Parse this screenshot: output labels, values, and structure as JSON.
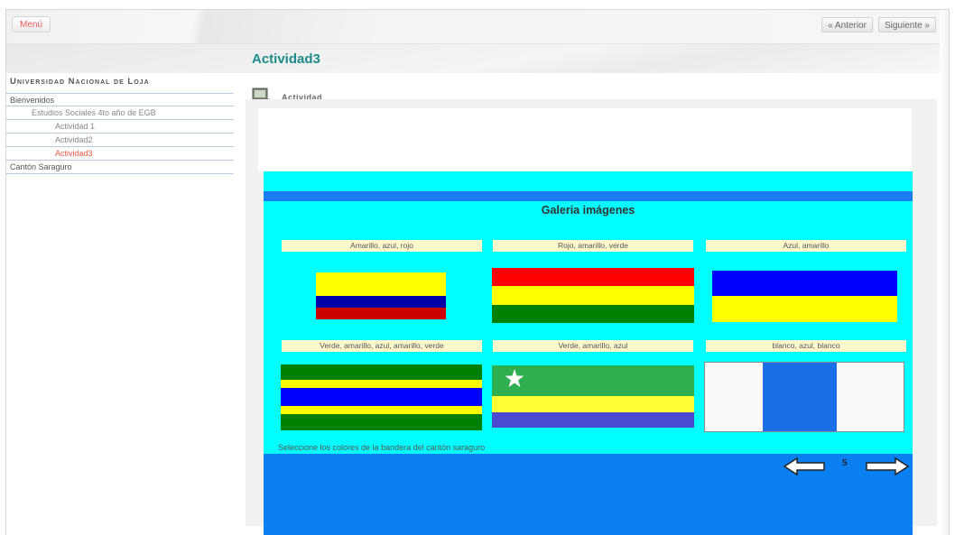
{
  "topbar": {
    "menu_label": "Menú",
    "prev_label": "« Anterior",
    "next_label": "Siguiente »"
  },
  "page_title": "Actividad3",
  "sidebar": {
    "university": "Universidad Nacional de Loja",
    "items": [
      {
        "label": "Bienvenidos",
        "level": 0
      },
      {
        "label": "Estudios Sociales 4to año de EGB",
        "level": 1
      },
      {
        "label": "Actividad 1",
        "level": 2
      },
      {
        "label": "Actividad2",
        "level": 2
      },
      {
        "label": "Actividad3",
        "level": 2,
        "active": true
      },
      {
        "label": "Cantón Saraguro",
        "level": 0
      }
    ]
  },
  "activity": {
    "header_label": "Actividad",
    "gallery_title": "Galeria imágenes",
    "captions": [
      "Amarillo, azul, rojo",
      "Rojo, amarillo, verde",
      "Azul, amarillo",
      "Verde, amarillo, azul, amarillo, verde",
      "Verde, amarillo, azul",
      "blanco, azul, blanco"
    ],
    "instruction": "Seleccione los colores de la bandera del cantón saraguro",
    "page_number": "5"
  },
  "colors": {
    "accent_title": "#1e8a8a",
    "stage_bg": "#00ffff",
    "stage_bar": "#1a7cf0",
    "active_item": "#ee5a4a",
    "caption_bg": "#fff9cc"
  },
  "icons": [
    "activity-icon",
    "arrow-left-icon",
    "arrow-right-icon",
    "star-icon"
  ]
}
